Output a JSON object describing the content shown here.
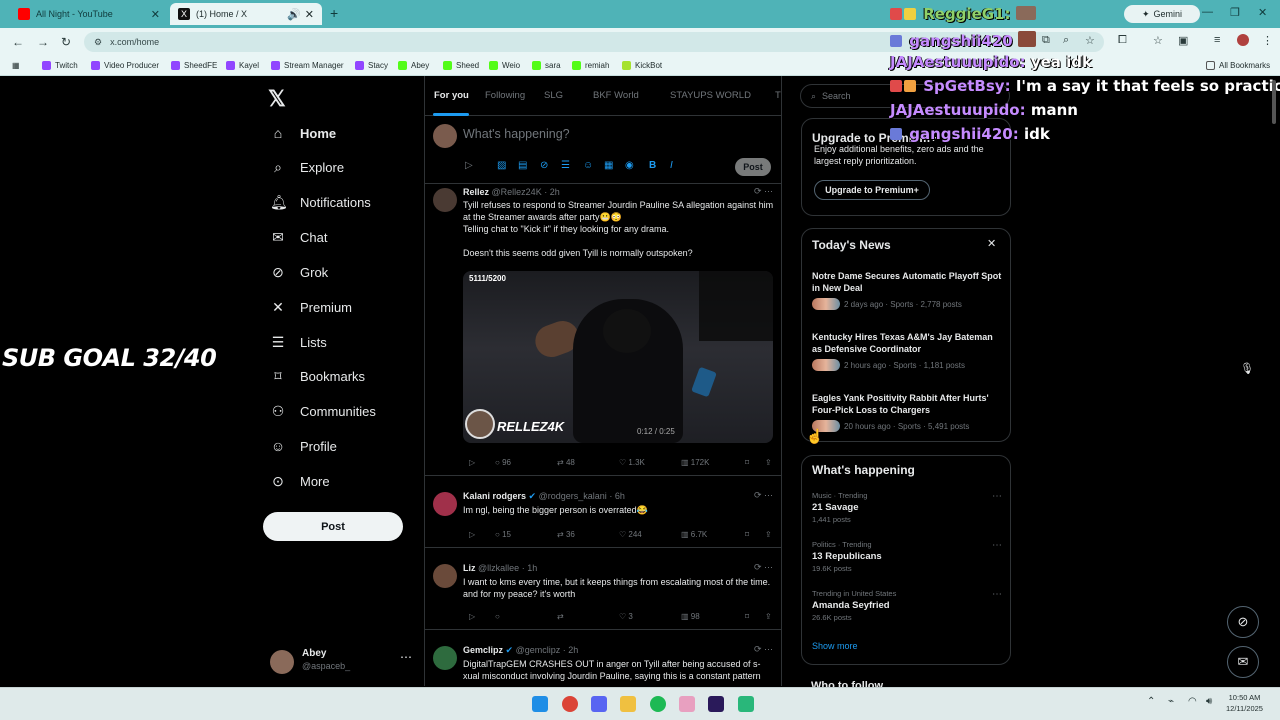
{
  "browser": {
    "tabs": [
      {
        "title": "All Night - YouTube",
        "favicon_color": "#ff0000"
      },
      {
        "title": "(1) Home / X",
        "favicon_color": "#000000"
      }
    ],
    "gemini_label": "Gemini",
    "url": "x.com/home",
    "bookmarks": [
      "Twitch",
      "Video Producer",
      "SheedFE",
      "Kayel",
      "Stream Manager",
      "Stacy",
      "Abey",
      "Sheed",
      "Weio",
      "sara",
      "remiah",
      "KickBot"
    ],
    "all_bookmarks": "All Bookmarks"
  },
  "nav": {
    "items": [
      {
        "label": "Home",
        "icon": "home-icon"
      },
      {
        "label": "Explore",
        "icon": "search-icon"
      },
      {
        "label": "Notifications",
        "icon": "bell-icon"
      },
      {
        "label": "Chat",
        "icon": "mail-icon"
      },
      {
        "label": "Grok",
        "icon": "grok-icon"
      },
      {
        "label": "Premium",
        "icon": "x-icon"
      },
      {
        "label": "Lists",
        "icon": "list-icon"
      },
      {
        "label": "Bookmarks",
        "icon": "bookmark-icon"
      },
      {
        "label": "Communities",
        "icon": "people-icon"
      },
      {
        "label": "Profile",
        "icon": "person-icon"
      },
      {
        "label": "More",
        "icon": "more-circle-icon"
      }
    ],
    "post_label": "Post",
    "account": {
      "name": "Abey",
      "handle": "@aspaceb_"
    }
  },
  "overlay": {
    "sub_goal": "SUB GOAL 32/40"
  },
  "feed": {
    "tabs": [
      "For you",
      "Following",
      "SLG",
      "BKF World",
      "STAYUPS WORLD",
      "Ti"
    ],
    "compose_placeholder": "What's happening?",
    "compose_post": "Post",
    "tweets": [
      {
        "name": "Rellez",
        "handle": "@Rellez24K",
        "time": "2h",
        "text": "Tyill refuses to respond to Streamer Jourdin Pauline SA allegation against him at the Streamer awards after party😬😳\nTelling chat to \"Kick it\" if they looking for any drama.\n\nDoesn't this seems odd given Tyill is normally outspoken?",
        "media_counter": "5111/5200",
        "media_watermark": "RELLEZ4K",
        "media_time": "0:12 / 0:25",
        "replies": "96",
        "reposts": "48",
        "likes": "1.3K",
        "views": "172K"
      },
      {
        "name": "Kalani rodgers",
        "handle": "@rodgers_kalani",
        "time": "6h",
        "text": "Im ngl, being the bigger person is overrated😂",
        "replies": "15",
        "reposts": "36",
        "likes": "244",
        "views": "6.7K"
      },
      {
        "name": "Liz",
        "handle": "@llzkallee",
        "time": "1h",
        "text": "I want to kms every time, but it keeps things from escalating most of the time. and for my peace? it's worth",
        "replies": "",
        "reposts": "",
        "likes": "3",
        "views": "98"
      },
      {
        "name": "Gemclipz",
        "handle": "@gemclipz",
        "time": "2h",
        "text": "DigitalTrapGEM CRASHES OUT in anger on Tyill after being accused of s-xual misconduct involving Jourdin Pauline, saying this is a constant pattern"
      }
    ]
  },
  "right": {
    "search_placeholder": "Search",
    "premium": {
      "title": "Upgrade to Premium+",
      "desc": "Enjoy additional benefits, zero ads and the largest reply prioritization.",
      "button": "Upgrade to Premium+"
    },
    "news": {
      "title": "Today's News",
      "items": [
        {
          "headline": "Notre Dame Secures Automatic Playoff Spot in New Deal",
          "meta": "2 days ago · Sports · 2,778 posts"
        },
        {
          "headline": "Kentucky Hires Texas A&M's Jay Bateman as Defensive Coordinator",
          "meta": "2 hours ago · Sports · 1,181 posts"
        },
        {
          "headline": "Eagles Yank Positivity Rabbit After Hurts' Four-Pick Loss to Chargers",
          "meta": "20 hours ago · Sports · 5,491 posts"
        }
      ]
    },
    "happening": {
      "title": "What's happening",
      "trends": [
        {
          "context": "Music · Trending",
          "name": "21 Savage",
          "posts": "1,441 posts"
        },
        {
          "context": "Politics · Trending",
          "name": "13 Republicans",
          "posts": "19.6K posts"
        },
        {
          "context": "Trending in United States",
          "name": "Amanda Seyfried",
          "posts": "26.6K posts"
        }
      ],
      "show_more": "Show more"
    },
    "who_to_follow": "Who to follow"
  },
  "chat": [
    {
      "user": "ReggieG1:",
      "msg": "",
      "color": "#8fd16a"
    },
    {
      "user": "gangshii420",
      "msg": "",
      "color": "#c58bff"
    },
    {
      "user": "JAJAestuuupido:",
      "msg": "yea idk",
      "color": "#c58bff"
    },
    {
      "user": "SpGetBsy:",
      "msg": "I'm a say it that feels so practiced",
      "color": "#c58bff"
    },
    {
      "user": "JAJAestuuupido:",
      "msg": "mann",
      "color": "#c58bff"
    },
    {
      "user": "gangshii420:",
      "msg": "idk",
      "color": "#c58bff"
    }
  ],
  "taskbar": {
    "time": "10:50 AM",
    "date": "12/11/2025"
  }
}
